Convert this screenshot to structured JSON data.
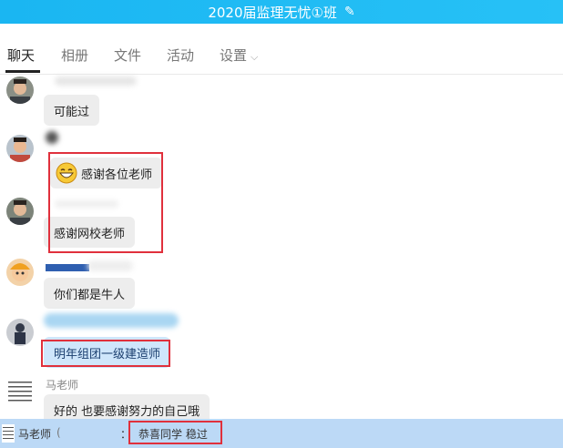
{
  "title": {
    "text": "2020届监理无忧①班",
    "edit_icon": "✎"
  },
  "tabs": [
    {
      "label": "聊天",
      "active": true
    },
    {
      "label": "相册"
    },
    {
      "label": "文件"
    },
    {
      "label": "活动"
    },
    {
      "label": "设置",
      "chevron": "⌵"
    }
  ],
  "messages": [
    {
      "text": "可能过"
    },
    {
      "text": "感谢各位老师",
      "emoji": "grinning-face-icon"
    },
    {
      "text": "感谢网校老师"
    },
    {
      "text": "你们都是牛人"
    },
    {
      "text": "明年组团一级建造师"
    },
    {
      "sender": "马老师",
      "text": "好的 也要感谢努力的自己哦"
    }
  ],
  "bottom_bar": {
    "name": "马老师",
    "name_suffix": "(",
    "separator": "：",
    "message": "恭喜同学 稳过"
  },
  "colors": {
    "title_bar": "#1ab6f2",
    "highlight": "#e0303c",
    "bottom_bar": "#bcd9f6"
  }
}
